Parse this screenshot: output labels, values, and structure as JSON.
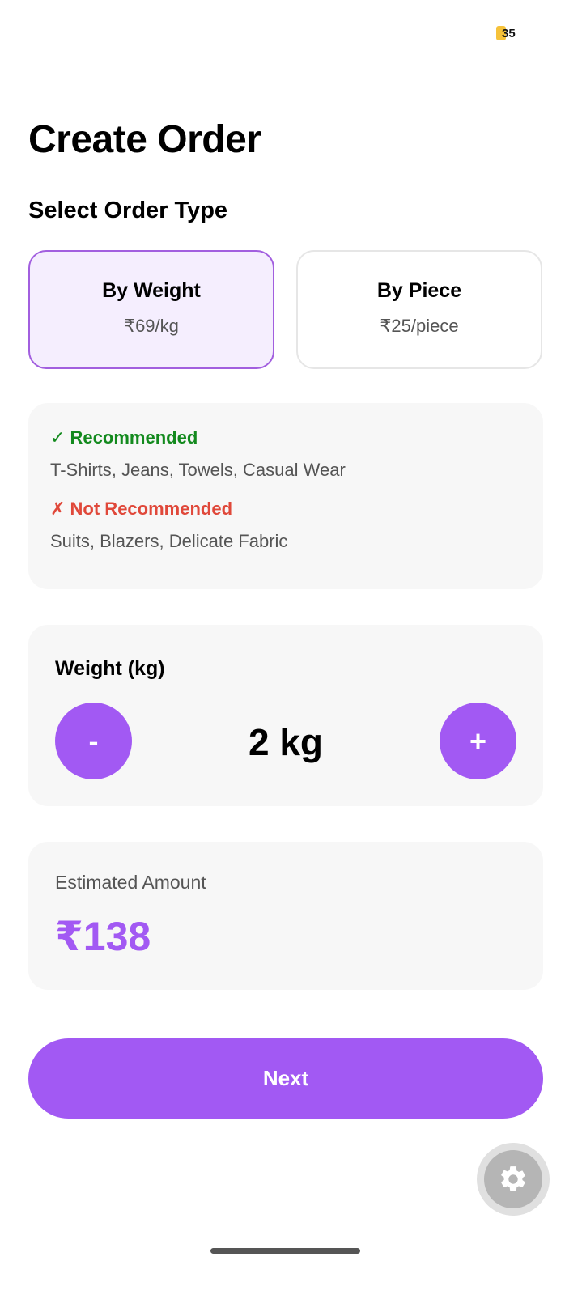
{
  "status_bar": {
    "badge_number": "35",
    "badge_color": "#f6c23a"
  },
  "header": {
    "title": "Create Order"
  },
  "order_type": {
    "section_title": "Select Order Type",
    "options": [
      {
        "title": "By Weight",
        "price": "₹69/kg",
        "selected": true
      },
      {
        "title": "By Piece",
        "price": "₹25/piece",
        "selected": false
      }
    ]
  },
  "recommendations": {
    "recommended_label": "✓ Recommended",
    "recommended_items": "T-Shirts, Jeans, Towels, Casual Wear",
    "not_recommended_label": "✗ Not Recommended",
    "not_recommended_items": "Suits, Blazers, Delicate Fabric"
  },
  "weight": {
    "label": "Weight (kg)",
    "value": "2 kg",
    "minus_label": "-",
    "plus_label": "+"
  },
  "estimate": {
    "label": "Estimated Amount",
    "amount": "₹138"
  },
  "footer": {
    "next_label": "Next"
  },
  "floating": {
    "icon": "gear-icon"
  },
  "colors": {
    "accent": "#a259f3",
    "selected_bg": "#f5eefe",
    "selected_border": "#a25fdf",
    "recommended": "#138a1e",
    "not_recommended": "#e0483a"
  }
}
